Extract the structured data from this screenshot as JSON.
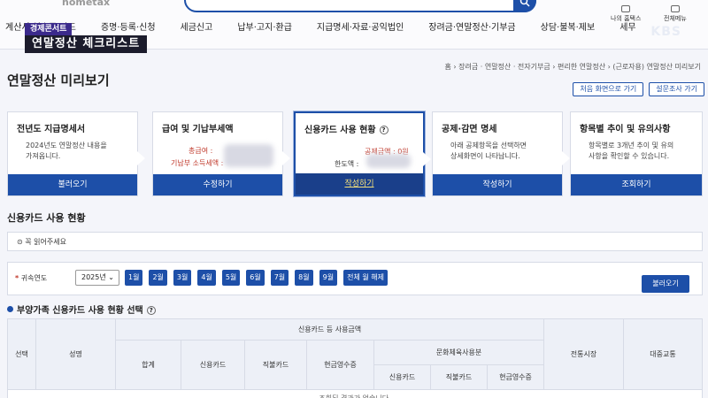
{
  "header": {
    "logo_cut": "hometax",
    "nav": [
      "계산서·영수증·카드",
      "증명·등록·신청",
      "세금신고",
      "납부·고지·환급",
      "지급명세·자료·공익법인",
      "장려금·연말정산·기부금",
      "상담·불복·제보",
      "세무"
    ],
    "util": [
      {
        "label": "나의 홈택스",
        "icon": "user-icon"
      },
      {
        "label": "전체메뉴",
        "icon": "menu-icon"
      }
    ]
  },
  "broadcast": {
    "tag": "경제콘서트",
    "title": "연말정산 체크리스트",
    "channel": "KBS"
  },
  "breadcrumb": "홈 › 장려금 · 연말정산 · 전자기부금 › 편리한 연말정산 › (근로자용) 연말정산 미리보기",
  "page_title": "연말정산 미리보기",
  "buttons": {
    "first_screen": "처음 화면으로 가기",
    "survey": "설문조사 가기"
  },
  "steps": [
    {
      "title": "전년도 지급명세서",
      "desc": [
        "2024년도 연말정산 내용을",
        "가져옵니다."
      ],
      "button": "불러오기"
    },
    {
      "title": "급여 및 기납부세액",
      "fields": [
        "총급여 :",
        "기납부 소득세액 :"
      ],
      "button": "수정하기"
    },
    {
      "title": "신용카드 사용 현황",
      "fields": [
        "공제금액 : 0원",
        "한도액 :"
      ],
      "button": "작성하기"
    },
    {
      "title": "공제·감면 명세",
      "desc": [
        "아래 공제항목을 선택하면",
        "상세화면이 나타납니다."
      ],
      "button": "작성하기"
    },
    {
      "title": "항목별 추이 및 유의사항",
      "desc": [
        "항목별로 3개년 추이 및 유의",
        "사항을 확인할 수 있습니다."
      ],
      "button": "조회하기"
    }
  ],
  "section_title": "신용카드 사용 현황",
  "notice": "꼭 읽어주세요",
  "filter": {
    "label_mark": "*",
    "label": "귀속연도",
    "year": "2025년",
    "months": [
      "1월",
      "2월",
      "3월",
      "4월",
      "5월",
      "6월",
      "7월",
      "8월",
      "9월"
    ],
    "clear_all": "전체 월 해제",
    "load": "불러오기"
  },
  "subsection_title": "부양가족 신용카드 사용 현황 선택",
  "table": {
    "headers": {
      "select": "선택",
      "name": "성명",
      "group": "신용카드 등 사용금액",
      "total": "합계",
      "credit_card": "신용카드",
      "debit_card": "직불카드",
      "cash_receipt": "현금영수증",
      "culture_group": "문화체육사용분",
      "culture_credit": "신용카드",
      "culture_debit": "직불카드",
      "culture_cash": "현금영수증",
      "market": "전통시장",
      "transit": "대중교통"
    },
    "empty": "조회된 결과가 없습니다."
  }
}
